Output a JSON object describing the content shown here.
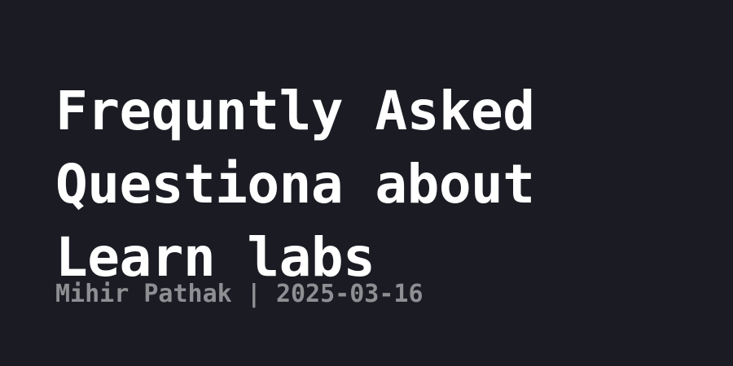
{
  "title": {
    "lines": [
      "Frequntly Asked",
      "Questiona about",
      "Learn labs"
    ]
  },
  "byline": {
    "author": "Mihir Pathak",
    "separator": " | ",
    "date": "2025-03-16"
  },
  "colors": {
    "background": "#1b1c23",
    "title": "#ffffff",
    "byline": "#8e8f93"
  }
}
